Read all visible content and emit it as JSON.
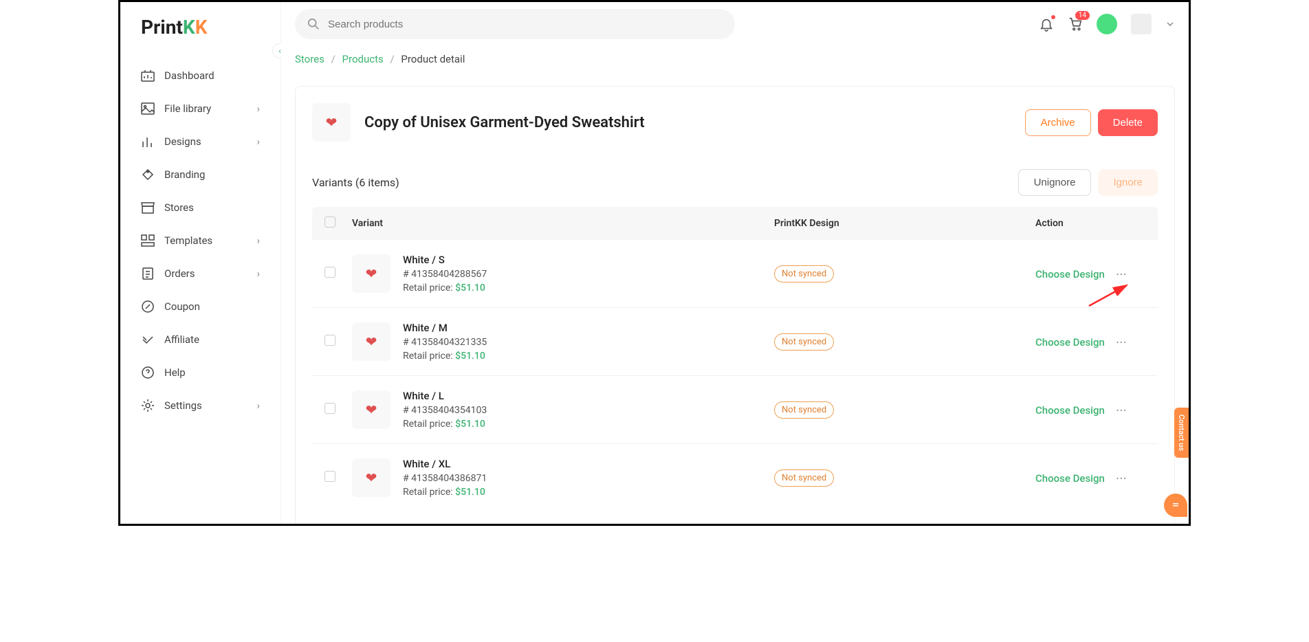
{
  "logo": {
    "part1": "Print",
    "part2": "K",
    "part3": "K"
  },
  "search": {
    "placeholder": "Search products"
  },
  "topbar": {
    "cart_count": "14"
  },
  "breadcrumbs": {
    "stores": "Stores",
    "products": "Products",
    "detail": "Product detail"
  },
  "product": {
    "title": "Copy of Unisex Garment-Dyed Sweatshirt"
  },
  "buttons": {
    "archive": "Archive",
    "delete": "Delete",
    "unignore": "Unignore",
    "ignore": "Ignore"
  },
  "variants_label": "Variants (6 items)",
  "table": {
    "col_variant": "Variant",
    "col_design": "PrintKK Design",
    "col_action": "Action"
  },
  "labels": {
    "retail_price": "Retail price:",
    "not_synced": "Not synced",
    "choose_design": "Choose Design"
  },
  "rows": [
    {
      "name": "White / S",
      "sku": "# 41358404288567",
      "price": "$51.10"
    },
    {
      "name": "White / M",
      "sku": "# 41358404321335",
      "price": "$51.10"
    },
    {
      "name": "White / L",
      "sku": "# 41358404354103",
      "price": "$51.10"
    },
    {
      "name": "White / XL",
      "sku": "# 41358404386871",
      "price": "$51.10"
    }
  ],
  "sidebar": {
    "items": [
      {
        "label": "Dashboard"
      },
      {
        "label": "File library"
      },
      {
        "label": "Designs"
      },
      {
        "label": "Branding"
      },
      {
        "label": "Stores"
      },
      {
        "label": "Templates"
      },
      {
        "label": "Orders"
      },
      {
        "label": "Coupon"
      },
      {
        "label": "Affiliate"
      },
      {
        "label": "Help"
      },
      {
        "label": "Settings"
      }
    ]
  },
  "contact_label": "Contact us"
}
